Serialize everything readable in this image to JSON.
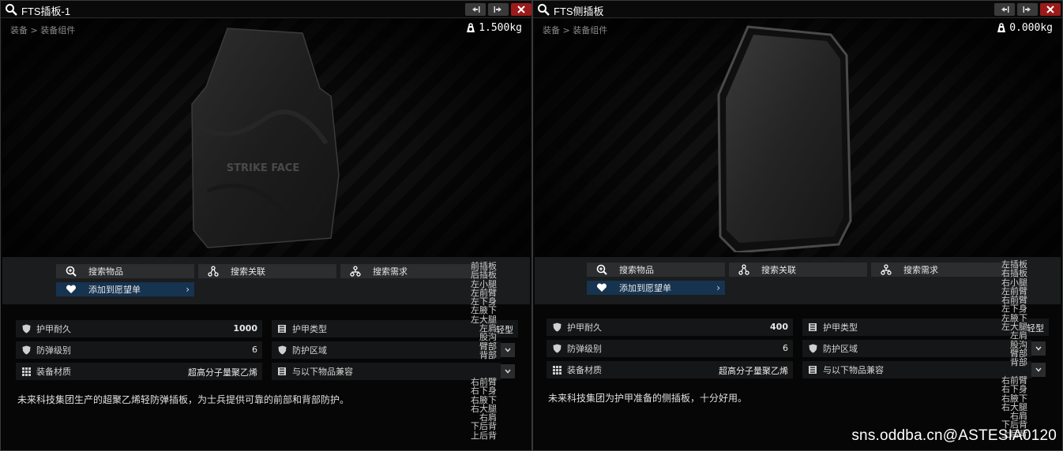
{
  "colors": {
    "close": "#9b1b1b",
    "wishlist": "#163350",
    "panel_bg": "#060606",
    "action_bar": "#1a1c1d"
  },
  "left": {
    "title": "FTS插板-1",
    "breadcrumb": "装备 > 装备组件",
    "weight": "1.500kg",
    "plate_text": "STRIKE FACE",
    "actions": {
      "search_item": "搜索物品",
      "search_related": "搜索关联",
      "search_required": "搜索需求",
      "add_wishlist": "添加到愿望单"
    },
    "stats": {
      "durability_label": "护甲耐久",
      "durability_value": "1000",
      "class_label": "防弹级别",
      "class_value": "6",
      "material_label": "装备材质",
      "material_value": "超高分子量聚乙烯",
      "armor_type_label": "护甲类型",
      "armor_type_value": "轻型",
      "zones_label": "防护区域",
      "compatible_label": "与以下物品兼容"
    },
    "description": "未来科技集团生产的超聚乙烯轻防弹插板，为士兵提供可靠的前部和背部防护。",
    "zones": [
      "前插板",
      "后插板",
      "左小腿",
      "左前臂",
      "左下身",
      "左腋下",
      "左大腿",
      "左肩",
      "股沟",
      "臂部",
      "背部"
    ],
    "zones_bottom": [
      "右前臂",
      "右下身",
      "右腋下",
      "右大腿",
      "右肩",
      "下后背",
      "上后背"
    ]
  },
  "right": {
    "title": "FTS侧插板",
    "breadcrumb": "装备 > 装备组件",
    "weight": "0.000kg",
    "actions": {
      "search_item": "搜索物品",
      "search_related": "搜索关联",
      "search_required": "搜索需求",
      "add_wishlist": "添加到愿望单"
    },
    "stats": {
      "durability_label": "护甲耐久",
      "durability_value": "400",
      "class_label": "防弹级别",
      "class_value": "6",
      "material_label": "装备材质",
      "material_value": "超高分子量聚乙烯",
      "armor_type_label": "护甲类型",
      "armor_type_value": "轻型",
      "zones_label": "防护区域",
      "compatible_label": "与以下物品兼容"
    },
    "description": "未来科技集团为护甲准备的侧插板，十分好用。",
    "zones": [
      "左插板",
      "右插板",
      "右小腿",
      "左前臂",
      "右前臂",
      "左下身",
      "左腋下",
      "左大腿",
      "左肩",
      "股沟",
      "臂部",
      "背部"
    ],
    "zones_bottom": [
      "右前臂",
      "右下身",
      "右腋下",
      "右大腿",
      "右肩",
      "下后背",
      "上后背"
    ]
  },
  "watermark": "sns.oddba.cn@ASTESIA0120"
}
